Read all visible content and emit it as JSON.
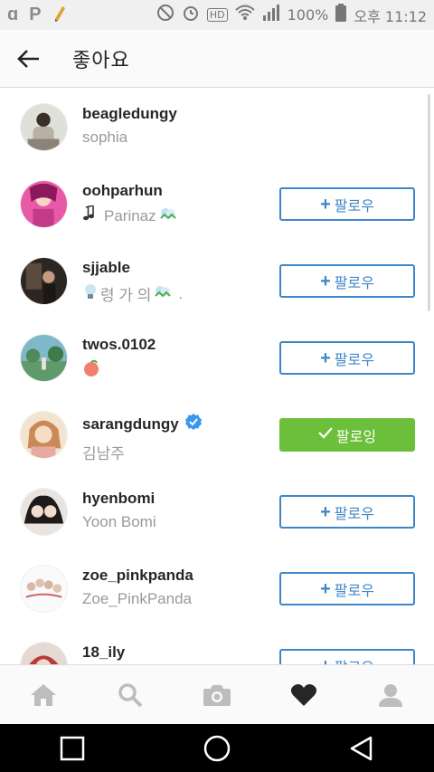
{
  "status_bar": {
    "battery": "100%",
    "time": "오후 11:12",
    "network": "HD"
  },
  "header": {
    "title": "좋아요"
  },
  "likers": [
    {
      "username": "beagledungy",
      "full_name": "sophia",
      "follow_state": "none"
    },
    {
      "username": "oohparhun",
      "full_name": "Parinaz",
      "follow_state": "follow",
      "follow_label": "팔로우"
    },
    {
      "username": "sjjable",
      "full_name": "령 가 의",
      "follow_state": "follow",
      "follow_label": "팔로우"
    },
    {
      "username": "twos.0102",
      "full_name": "",
      "follow_state": "follow",
      "follow_label": "팔로우"
    },
    {
      "username": "sarangdungy",
      "full_name": "김남주",
      "verified": true,
      "follow_state": "following",
      "follow_label": "팔로잉"
    },
    {
      "username": "hyenbomi",
      "full_name": "Yoon Bomi",
      "follow_state": "follow",
      "follow_label": "팔로우"
    },
    {
      "username": "zoe_pinkpanda",
      "full_name": "Zoe_PinkPanda",
      "follow_state": "follow",
      "follow_label": "팔로우"
    },
    {
      "username": "18_ily",
      "full_name": "",
      "follow_state": "follow",
      "follow_label": "팔로우"
    }
  ],
  "tabs": [
    "home-icon",
    "search-icon",
    "camera-icon",
    "heart-icon",
    "profile-icon"
  ],
  "colors": {
    "follow_blue": "#3f86c8",
    "following_green": "#6bbf3a",
    "verified_blue": "#3897f0"
  }
}
